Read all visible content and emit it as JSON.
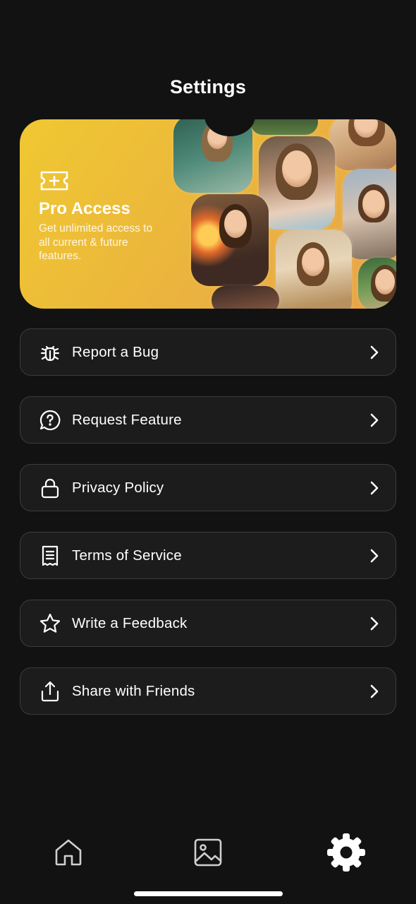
{
  "header": {
    "title": "Settings"
  },
  "pro_banner": {
    "title": "Pro Access",
    "description": "Get unlimited access to all current & future features.",
    "icon": "ticket-plus-icon",
    "gradient_colors": [
      "#f0c832",
      "#e7a34a"
    ]
  },
  "menu": {
    "items": [
      {
        "label": "Report a Bug",
        "icon": "bug-icon"
      },
      {
        "label": "Request Feature",
        "icon": "question-chat-icon"
      },
      {
        "label": "Privacy Policy",
        "icon": "lock-icon"
      },
      {
        "label": "Terms of Service",
        "icon": "receipt-icon"
      },
      {
        "label": "Write a Feedback",
        "icon": "star-icon"
      },
      {
        "label": "Share with Friends",
        "icon": "share-icon"
      }
    ]
  },
  "bottom_nav": {
    "items": [
      {
        "icon": "home-icon",
        "active": false
      },
      {
        "icon": "gallery-icon",
        "active": false
      },
      {
        "icon": "settings-icon",
        "active": true
      }
    ]
  },
  "colors": {
    "background": "#121212",
    "card": "#1c1c1c",
    "card_border": "#3c3c3c",
    "text": "#ffffff"
  }
}
